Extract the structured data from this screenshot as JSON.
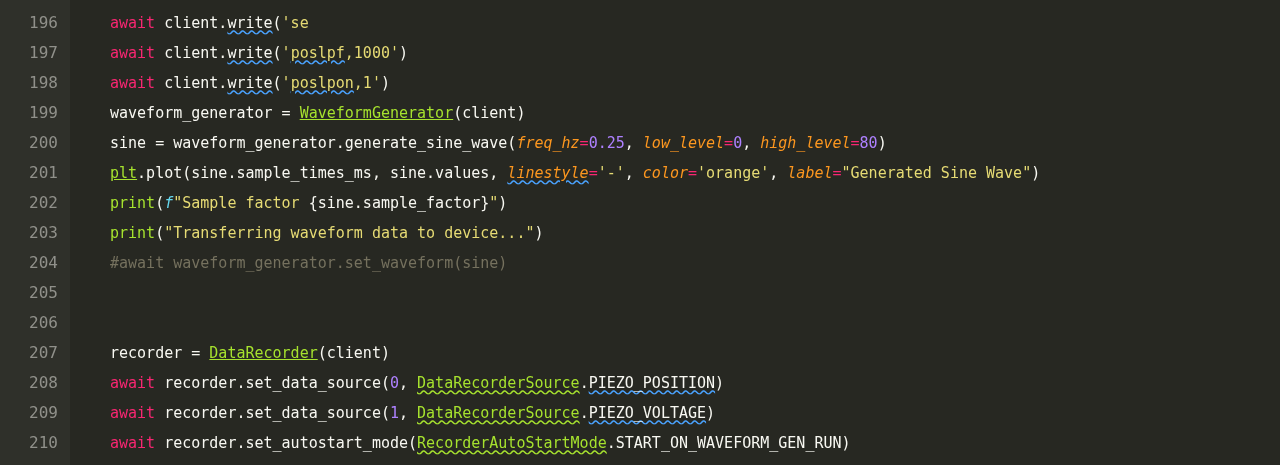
{
  "editor": {
    "lines": [
      {
        "number": "196",
        "tokens": [
          {
            "kind": "keyword",
            "text": "await"
          },
          {
            "kind": "plain",
            "text": " client."
          },
          {
            "kind": "plain",
            "text": "write",
            "squiggle": true
          },
          {
            "kind": "plain",
            "text": "("
          },
          {
            "kind": "string",
            "text": "'se"
          }
        ]
      },
      {
        "number": "197",
        "tokens": [
          {
            "kind": "keyword",
            "text": "await"
          },
          {
            "kind": "plain",
            "text": " client."
          },
          {
            "kind": "plain",
            "text": "write",
            "squiggle": true
          },
          {
            "kind": "plain",
            "text": "("
          },
          {
            "kind": "string",
            "text": "'"
          },
          {
            "kind": "string",
            "text": "poslpf",
            "squiggle": true
          },
          {
            "kind": "string",
            "text": ",1000'"
          },
          {
            "kind": "plain",
            "text": ")"
          }
        ]
      },
      {
        "number": "198",
        "tokens": [
          {
            "kind": "keyword",
            "text": "await"
          },
          {
            "kind": "plain",
            "text": " client."
          },
          {
            "kind": "plain",
            "text": "write",
            "squiggle": true
          },
          {
            "kind": "plain",
            "text": "("
          },
          {
            "kind": "string",
            "text": "'"
          },
          {
            "kind": "string",
            "text": "poslpon",
            "squiggle": true
          },
          {
            "kind": "string",
            "text": ",1'"
          },
          {
            "kind": "plain",
            "text": ")"
          }
        ]
      },
      {
        "number": "199",
        "tokens": [
          {
            "kind": "plain",
            "text": "waveform_generator = "
          },
          {
            "kind": "class",
            "text": "WaveformGenerator"
          },
          {
            "kind": "plain",
            "text": "(client)"
          }
        ]
      },
      {
        "number": "200",
        "tokens": [
          {
            "kind": "plain",
            "text": "sine = waveform_generator.generate_sine_wave("
          },
          {
            "kind": "param",
            "text": "freq_hz"
          },
          {
            "kind": "keyword",
            "text": "="
          },
          {
            "kind": "number",
            "text": "0.25"
          },
          {
            "kind": "plain",
            "text": ", "
          },
          {
            "kind": "param",
            "text": "low_level"
          },
          {
            "kind": "keyword",
            "text": "="
          },
          {
            "kind": "number",
            "text": "0"
          },
          {
            "kind": "plain",
            "text": ", "
          },
          {
            "kind": "param",
            "text": "high_level"
          },
          {
            "kind": "keyword",
            "text": "="
          },
          {
            "kind": "number",
            "text": "80"
          },
          {
            "kind": "plain",
            "text": ")"
          }
        ]
      },
      {
        "number": "201",
        "tokens": [
          {
            "kind": "class",
            "text": "plt"
          },
          {
            "kind": "plain",
            "text": ".plot(sine.sample_times_ms, sine.values, "
          },
          {
            "kind": "param",
            "text": "linestyle",
            "squiggle": true
          },
          {
            "kind": "keyword",
            "text": "="
          },
          {
            "kind": "string",
            "text": "'-'"
          },
          {
            "kind": "plain",
            "text": ", "
          },
          {
            "kind": "param",
            "text": "color"
          },
          {
            "kind": "keyword",
            "text": "="
          },
          {
            "kind": "string",
            "text": "'orange'"
          },
          {
            "kind": "plain",
            "text": ", "
          },
          {
            "kind": "param",
            "text": "label"
          },
          {
            "kind": "keyword",
            "text": "="
          },
          {
            "kind": "string",
            "text": "\"Generated Sine Wave\""
          },
          {
            "kind": "plain",
            "text": ")"
          }
        ]
      },
      {
        "number": "202",
        "tokens": [
          {
            "kind": "builtin",
            "text": "print"
          },
          {
            "kind": "plain",
            "text": "("
          },
          {
            "kind": "prefix",
            "text": "f"
          },
          {
            "kind": "string",
            "text": "\"Sample factor "
          },
          {
            "kind": "plain",
            "text": "{sine.sample_factor}"
          },
          {
            "kind": "string",
            "text": "\""
          },
          {
            "kind": "plain",
            "text": ")"
          }
        ]
      },
      {
        "number": "203",
        "tokens": [
          {
            "kind": "builtin",
            "text": "print"
          },
          {
            "kind": "plain",
            "text": "("
          },
          {
            "kind": "string",
            "text": "\"Transferring waveform data to device...\""
          },
          {
            "kind": "plain",
            "text": ")"
          }
        ]
      },
      {
        "number": "204",
        "tokens": [
          {
            "kind": "comment",
            "text": "#await waveform_generator.set_waveform(sine)"
          }
        ]
      },
      {
        "number": "205"
      },
      {
        "number": "206"
      },
      {
        "number": "207",
        "tokens": [
          {
            "kind": "plain",
            "text": "recorder = "
          },
          {
            "kind": "class",
            "text": "DataRecorder"
          },
          {
            "kind": "plain",
            "text": "(client)"
          }
        ]
      },
      {
        "number": "208",
        "tokens": [
          {
            "kind": "keyword",
            "text": "await"
          },
          {
            "kind": "plain",
            "text": " recorder.set_data_source("
          },
          {
            "kind": "number",
            "text": "0"
          },
          {
            "kind": "plain",
            "text": ", "
          },
          {
            "kind": "class",
            "text": "DataRecorderSource",
            "squiggle": true
          },
          {
            "kind": "plain",
            "text": "."
          },
          {
            "kind": "plain",
            "text": "PIEZO_POSITION",
            "squiggle": true
          },
          {
            "kind": "plain",
            "text": ")"
          }
        ]
      },
      {
        "number": "209",
        "tokens": [
          {
            "kind": "keyword",
            "text": "await"
          },
          {
            "kind": "plain",
            "text": " recorder.set_data_source("
          },
          {
            "kind": "number",
            "text": "1"
          },
          {
            "kind": "plain",
            "text": ", "
          },
          {
            "kind": "class",
            "text": "DataRecorderSource",
            "squiggle": true
          },
          {
            "kind": "plain",
            "text": "."
          },
          {
            "kind": "plain",
            "text": "PIEZO_VOLTAGE",
            "squiggle": true
          },
          {
            "kind": "plain",
            "text": ")"
          }
        ]
      },
      {
        "number": "210",
        "tokens": [
          {
            "kind": "keyword",
            "text": "await"
          },
          {
            "kind": "plain",
            "text": " recorder.set_autostart_mode("
          },
          {
            "kind": "class",
            "text": "RecorderAutoStartMode",
            "squiggle": true
          },
          {
            "kind": "plain",
            "text": ".START_ON_WAVEFORM_GEN_RUN)"
          }
        ]
      }
    ]
  }
}
